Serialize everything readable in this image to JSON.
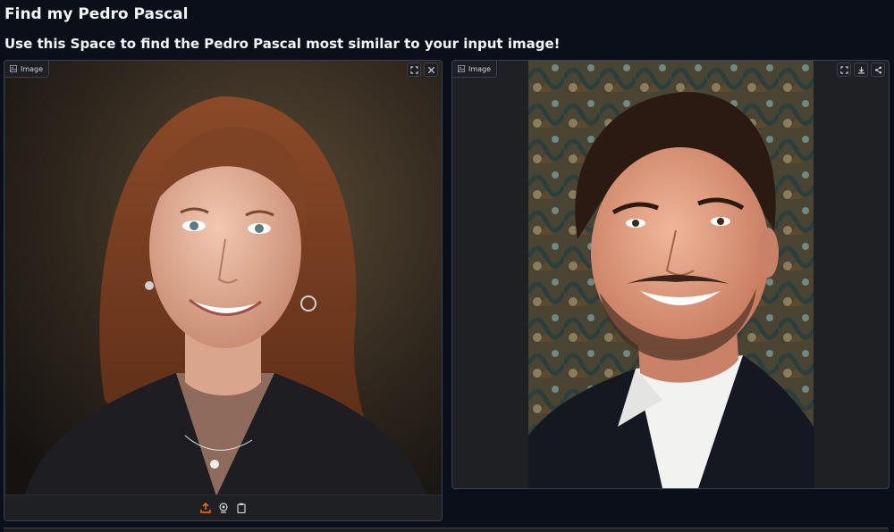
{
  "header": {
    "title": "Find my Pedro Pascal",
    "subtitle": "Use this Space to find the Pedro Pascal most similar to your input image!"
  },
  "input_panel": {
    "label": "Image",
    "image_alt": "Uploaded portrait photo",
    "tools": [
      "fullscreen-icon",
      "close-icon"
    ],
    "sources": [
      "upload-icon",
      "webcam-icon",
      "clipboard-icon"
    ],
    "active_source": "upload",
    "accent": "#f97316"
  },
  "output_panel": {
    "label": "Image",
    "image_alt": "Most similar Pedro Pascal photo",
    "tools": [
      "fullscreen-icon",
      "download-icon",
      "share-icon"
    ]
  }
}
